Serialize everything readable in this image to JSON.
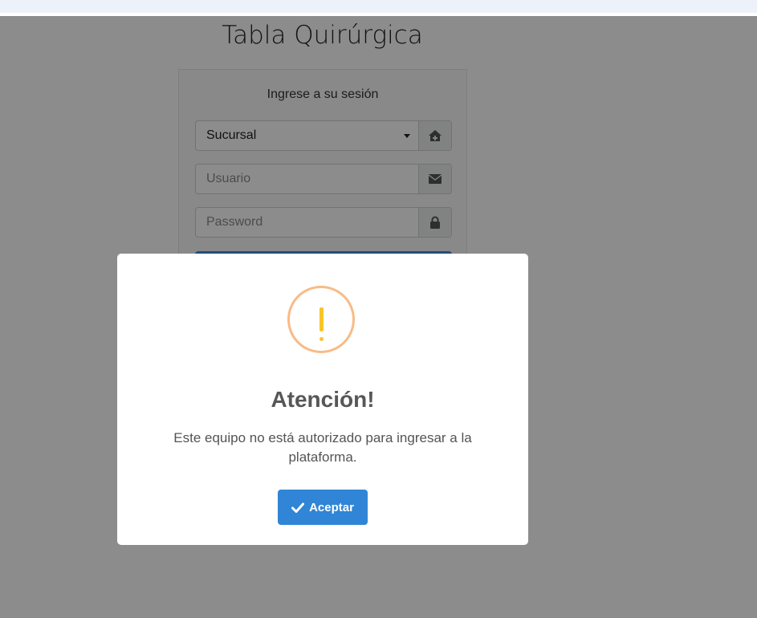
{
  "page": {
    "title": "Tabla Quirúrgica"
  },
  "login": {
    "subtitle": "Ingrese a su sesión",
    "branch_select": {
      "value": "Sucursal",
      "icon": "home-icon"
    },
    "username": {
      "placeholder": "Usuario",
      "icon": "envelope-icon"
    },
    "password": {
      "placeholder": "Password",
      "icon": "lock-icon"
    }
  },
  "alert": {
    "icon": "warning-icon",
    "title": "Atención!",
    "message": "Este equipo no está autorizado para ingresar a la plataforma.",
    "confirm_label": "Aceptar",
    "confirm_icon": "check-icon"
  },
  "colors": {
    "overlay": "rgba(0,0,0,0.45)",
    "primary_button": "#3085d6",
    "warning_ring": "#f8bb86",
    "warning_mark": "#f8c42a"
  }
}
